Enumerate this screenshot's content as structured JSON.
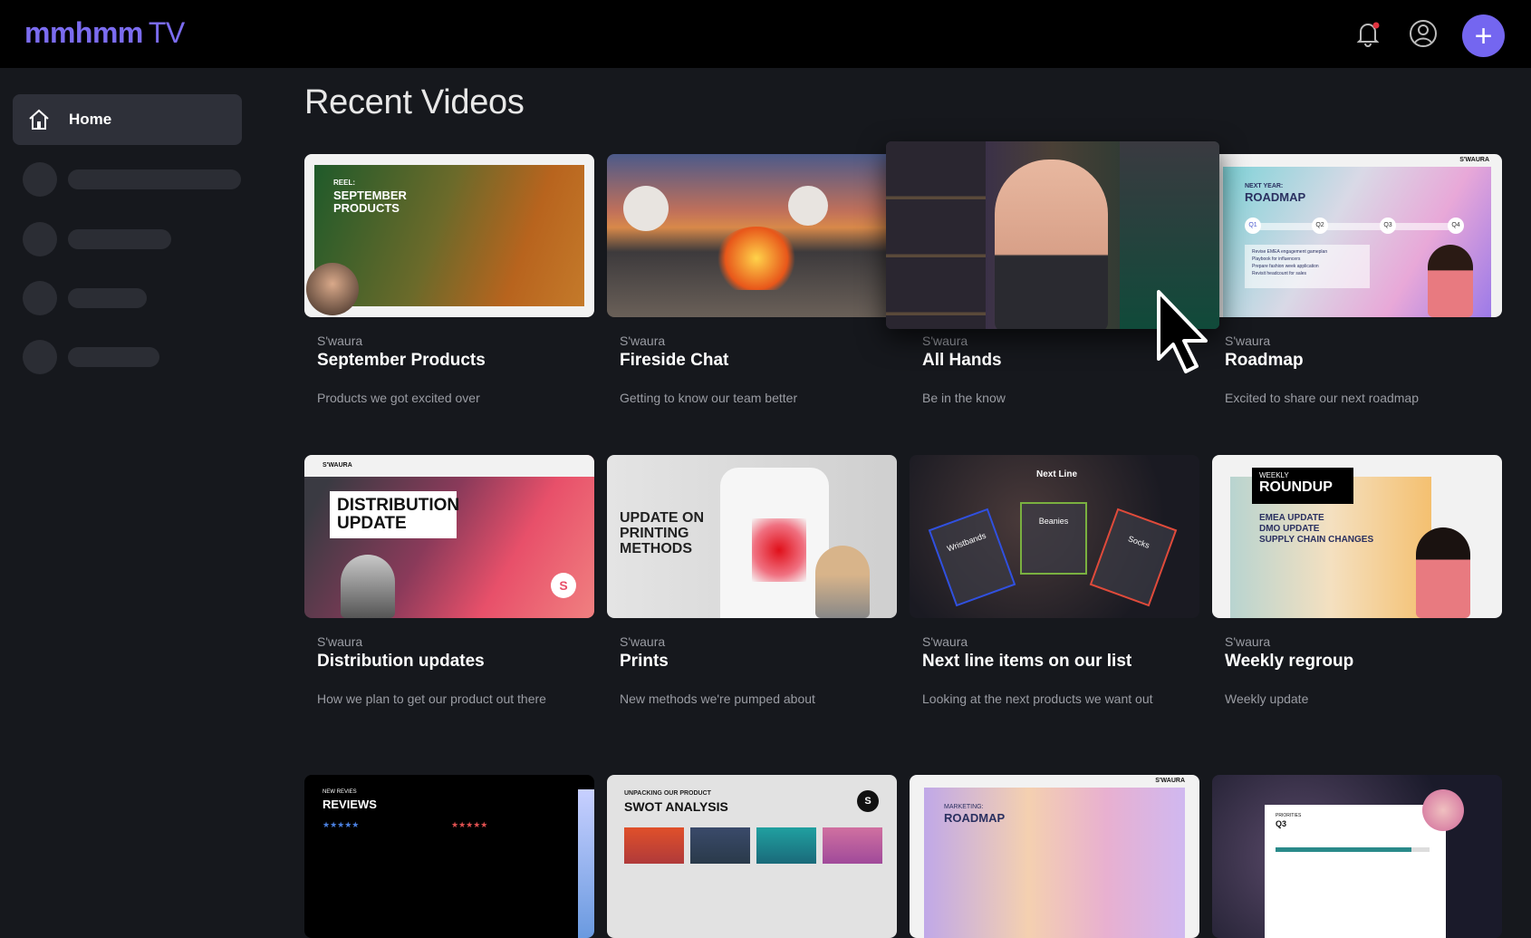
{
  "header": {
    "logo_bold": "mmhmm",
    "logo_light": "TV",
    "accent": "#7466f0",
    "notification_dot": "#e0333f"
  },
  "sidebar": {
    "home_label": "Home"
  },
  "main": {
    "title": "Recent Videos"
  },
  "videos": [
    {
      "channel": "S'waura",
      "title": "September Products",
      "description": "Products we got excited over",
      "thumb_text": [
        "REEL:",
        "SEPTEMBER PRODUCTS"
      ]
    },
    {
      "channel": "S'waura",
      "title": "Fireside Chat",
      "description": "Getting to know our team better"
    },
    {
      "channel": "S'waura",
      "title": "All Hands",
      "description": "Be in the know"
    },
    {
      "channel": "S'waura",
      "title": "Roadmap",
      "description": "Excited to share our next roadmap",
      "thumb_text": [
        "NEXT YEAR:",
        "ROADMAP",
        "Q1",
        "Q2",
        "Q3",
        "Q4",
        "Revise EMEA engagement gameplan",
        "Playbook for influencers",
        "Prepare fashion week application",
        "Revisit headcount for sales",
        "S'WAURA"
      ]
    },
    {
      "channel": "S'waura",
      "title": "Distribution updates",
      "description": "How we plan to get our product out there",
      "thumb_text": [
        "S'WAURA",
        "DISTRIBUTION UPDATE"
      ]
    },
    {
      "channel": "S'waura",
      "title": "Prints",
      "description": "New methods we're pumped about",
      "thumb_text": [
        "UPDATE ON PRINTING METHODS"
      ]
    },
    {
      "channel": "S'waura",
      "title": "Next line items on our list",
      "description": "Looking at the next products we want out",
      "thumb_text": [
        "Next Line",
        "Wristbands",
        "Beanies",
        "Socks"
      ]
    },
    {
      "channel": "S'waura",
      "title": "Weekly regroup",
      "description": "Weekly update",
      "thumb_text": [
        "WEEKLY",
        "ROUNDUP",
        "EMEA UPDATE",
        "DMO UPDATE",
        "SUPPLY CHAIN CHANGES"
      ]
    },
    {
      "thumb_text": [
        "NEW REVIES",
        "REVIEWS"
      ]
    },
    {
      "thumb_text": [
        "UNPACKING OUR PRODUCT",
        "SWOT ANALYSIS"
      ]
    },
    {
      "thumb_text": [
        "MARKETING:",
        "ROADMAP",
        "S'WAURA"
      ]
    },
    {
      "thumb_text": [
        "PRIORITIES",
        "Q3"
      ]
    }
  ]
}
